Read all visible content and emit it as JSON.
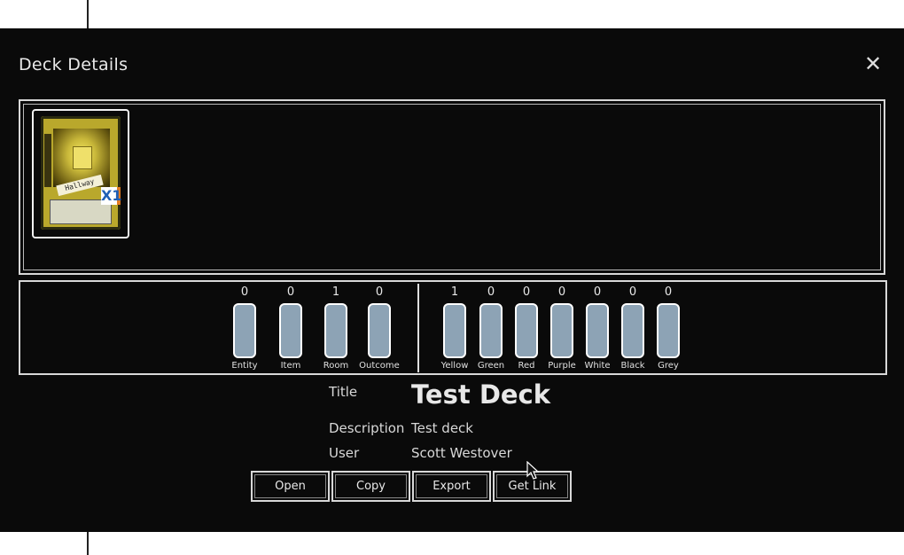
{
  "modal": {
    "title": "Deck Details",
    "close_icon": "close-icon"
  },
  "cards": [
    {
      "name": "Hallway",
      "count_label": "X1"
    }
  ],
  "card_types": [
    {
      "label": "Entity",
      "count": "0"
    },
    {
      "label": "Item",
      "count": "0"
    },
    {
      "label": "Room",
      "count": "1"
    },
    {
      "label": "Outcome",
      "count": "0"
    }
  ],
  "colors": [
    {
      "label": "Yellow",
      "count": "1"
    },
    {
      "label": "Green",
      "count": "0"
    },
    {
      "label": "Red",
      "count": "0"
    },
    {
      "label": "Purple",
      "count": "0"
    },
    {
      "label": "White",
      "count": "0"
    },
    {
      "label": "Black",
      "count": "0"
    },
    {
      "label": "Grey",
      "count": "0"
    }
  ],
  "info": {
    "title_label": "Title",
    "title_value": "Test Deck",
    "description_label": "Description",
    "description_value": "Test deck",
    "user_label": "User",
    "user_value": "Scott Westover"
  },
  "buttons": {
    "open": "Open",
    "copy": "Copy",
    "export": "Export",
    "get_link": "Get Link"
  },
  "style_colors": {
    "modal_bg": "#0a0a0a",
    "bar_fill": "#8da3b5",
    "card_gold": "#b9a82c",
    "count_blue": "#1f5fb5",
    "count_orange": "#e07b22"
  }
}
